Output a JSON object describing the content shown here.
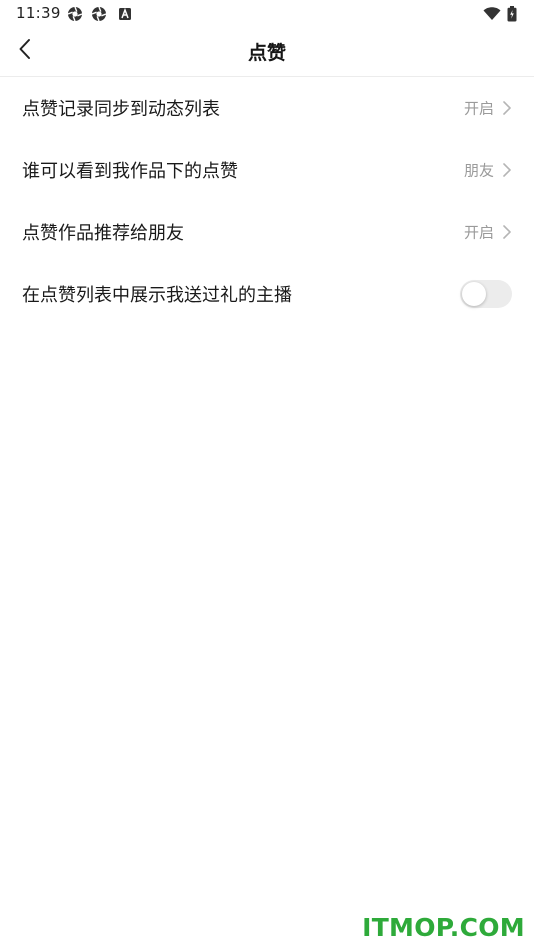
{
  "status_bar": {
    "time": "11:39",
    "left_icons": [
      "aperture-icon",
      "aperture-icon",
      "notification-a-icon"
    ],
    "right_icons": [
      "wifi-icon",
      "battery-icon"
    ]
  },
  "header": {
    "title": "点赞",
    "back_icon": "chevron-left-icon"
  },
  "settings": [
    {
      "label": "点赞记录同步到动态列表",
      "value": "开启",
      "type": "link"
    },
    {
      "label": "谁可以看到我作品下的点赞",
      "value": "朋友",
      "type": "link"
    },
    {
      "label": "点赞作品推荐给朋友",
      "value": "开启",
      "type": "link"
    },
    {
      "label": "在点赞列表中展示我送过礼的主播",
      "type": "toggle",
      "checked": false
    }
  ],
  "watermark": "ITMOP.COM",
  "colors": {
    "text_primary": "#1a1a1a",
    "text_secondary": "#9a9a9a",
    "toggle_off": "#ececec",
    "watermark": "#2eaa3a"
  }
}
